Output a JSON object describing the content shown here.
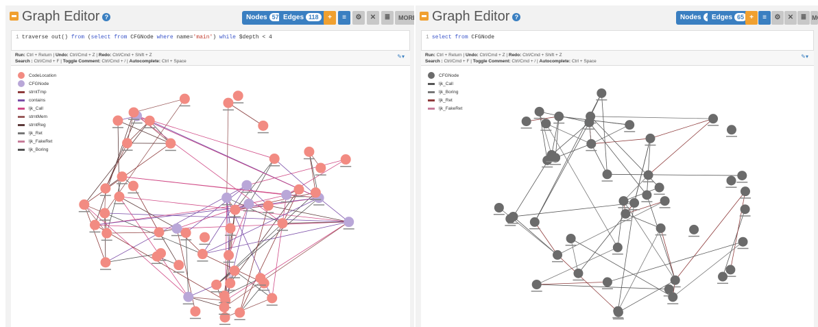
{
  "left": {
    "title": "Graph Editor",
    "help_icon": "question-icon",
    "nodes_label": "Nodes",
    "nodes_count": "57",
    "edges_label": "Edges",
    "edges_count": "118",
    "more_label": "MORE ▾",
    "query_gutter": "1",
    "query_parts": [
      "traverse out() ",
      "from",
      " (",
      "select from",
      " CFGNode ",
      "where",
      " name=",
      "'main'",
      ") ",
      "while",
      " $depth < 4"
    ],
    "hint_line1": [
      "Run:",
      " Ctrl + Return ",
      "Undo:",
      " Ctrl/Cmd + Z ",
      "Redo:",
      " Ctrl/Cmd + Shift + Z"
    ],
    "hint_line2": [
      "Search :",
      " Ctrl/Cmd + F ",
      "Toggle Comment:",
      " Ctrl/Cmd + / ",
      "Autocomplete:",
      " Ctrl + Space"
    ],
    "legend": [
      {
        "label": "CodeLocation",
        "kind": "dot",
        "color": "#f28b82"
      },
      {
        "label": "CFGNode",
        "kind": "dot",
        "color": "#b9a7d8"
      },
      {
        "label": "strntTmp",
        "kind": "line",
        "color": "#8e3b3b"
      },
      {
        "label": "contains",
        "kind": "line",
        "color": "#7b4ea8"
      },
      {
        "label": "ljk_Call",
        "kind": "line",
        "color": "#d04a86"
      },
      {
        "label": "strntMem",
        "kind": "line",
        "color": "#9a5b5b"
      },
      {
        "label": "strntReg",
        "kind": "line",
        "color": "#5c3a3a"
      },
      {
        "label": "ljk_Ret",
        "kind": "line",
        "color": "#777777"
      },
      {
        "label": "ljk_FakeRet",
        "kind": "line",
        "color": "#c77d9a"
      },
      {
        "label": "ljk_Boring",
        "kind": "line",
        "color": "#555555"
      }
    ]
  },
  "right": {
    "title": "Graph Editor",
    "help_icon": "question-icon",
    "nodes_label": "Nodes",
    "nodes_count": "47",
    "edges_label": "Edges",
    "edges_count": "65",
    "more_label": "MORE",
    "query_gutter": "1",
    "query_parts": [
      "select from",
      " CFGNode"
    ],
    "hint_line1": [
      "Run:",
      " Ctrl + Return ",
      "Undo:",
      " Ctrl/Cmd + Z ",
      "Redo:",
      " Ctrl/Cmd + Shift + Z"
    ],
    "hint_line2": [
      "Search :",
      " Ctrl/Cmd + F ",
      "Toggle Comment:",
      " Ctrl/Cmd + / ",
      "Autocomplete:",
      " Ctrl + Space"
    ],
    "legend": [
      {
        "label": "CFGNode",
        "kind": "dot",
        "color": "#6b6b6b"
      },
      {
        "label": "ljk_Call",
        "kind": "line",
        "color": "#555555"
      },
      {
        "label": "ljk_Boring",
        "kind": "line",
        "color": "#777777"
      },
      {
        "label": "ljk_Ret",
        "kind": "line",
        "color": "#8e3b3b"
      },
      {
        "label": "ljk_FakeRet",
        "kind": "line",
        "color": "#c77d9a"
      }
    ]
  },
  "colors": {
    "accent_blue": "#3a7fc1",
    "accent_orange": "#f0a030",
    "codelocation": "#f28b82",
    "cfgnode_left": "#b9a7d8",
    "cfgnode_right": "#6b6b6b"
  }
}
